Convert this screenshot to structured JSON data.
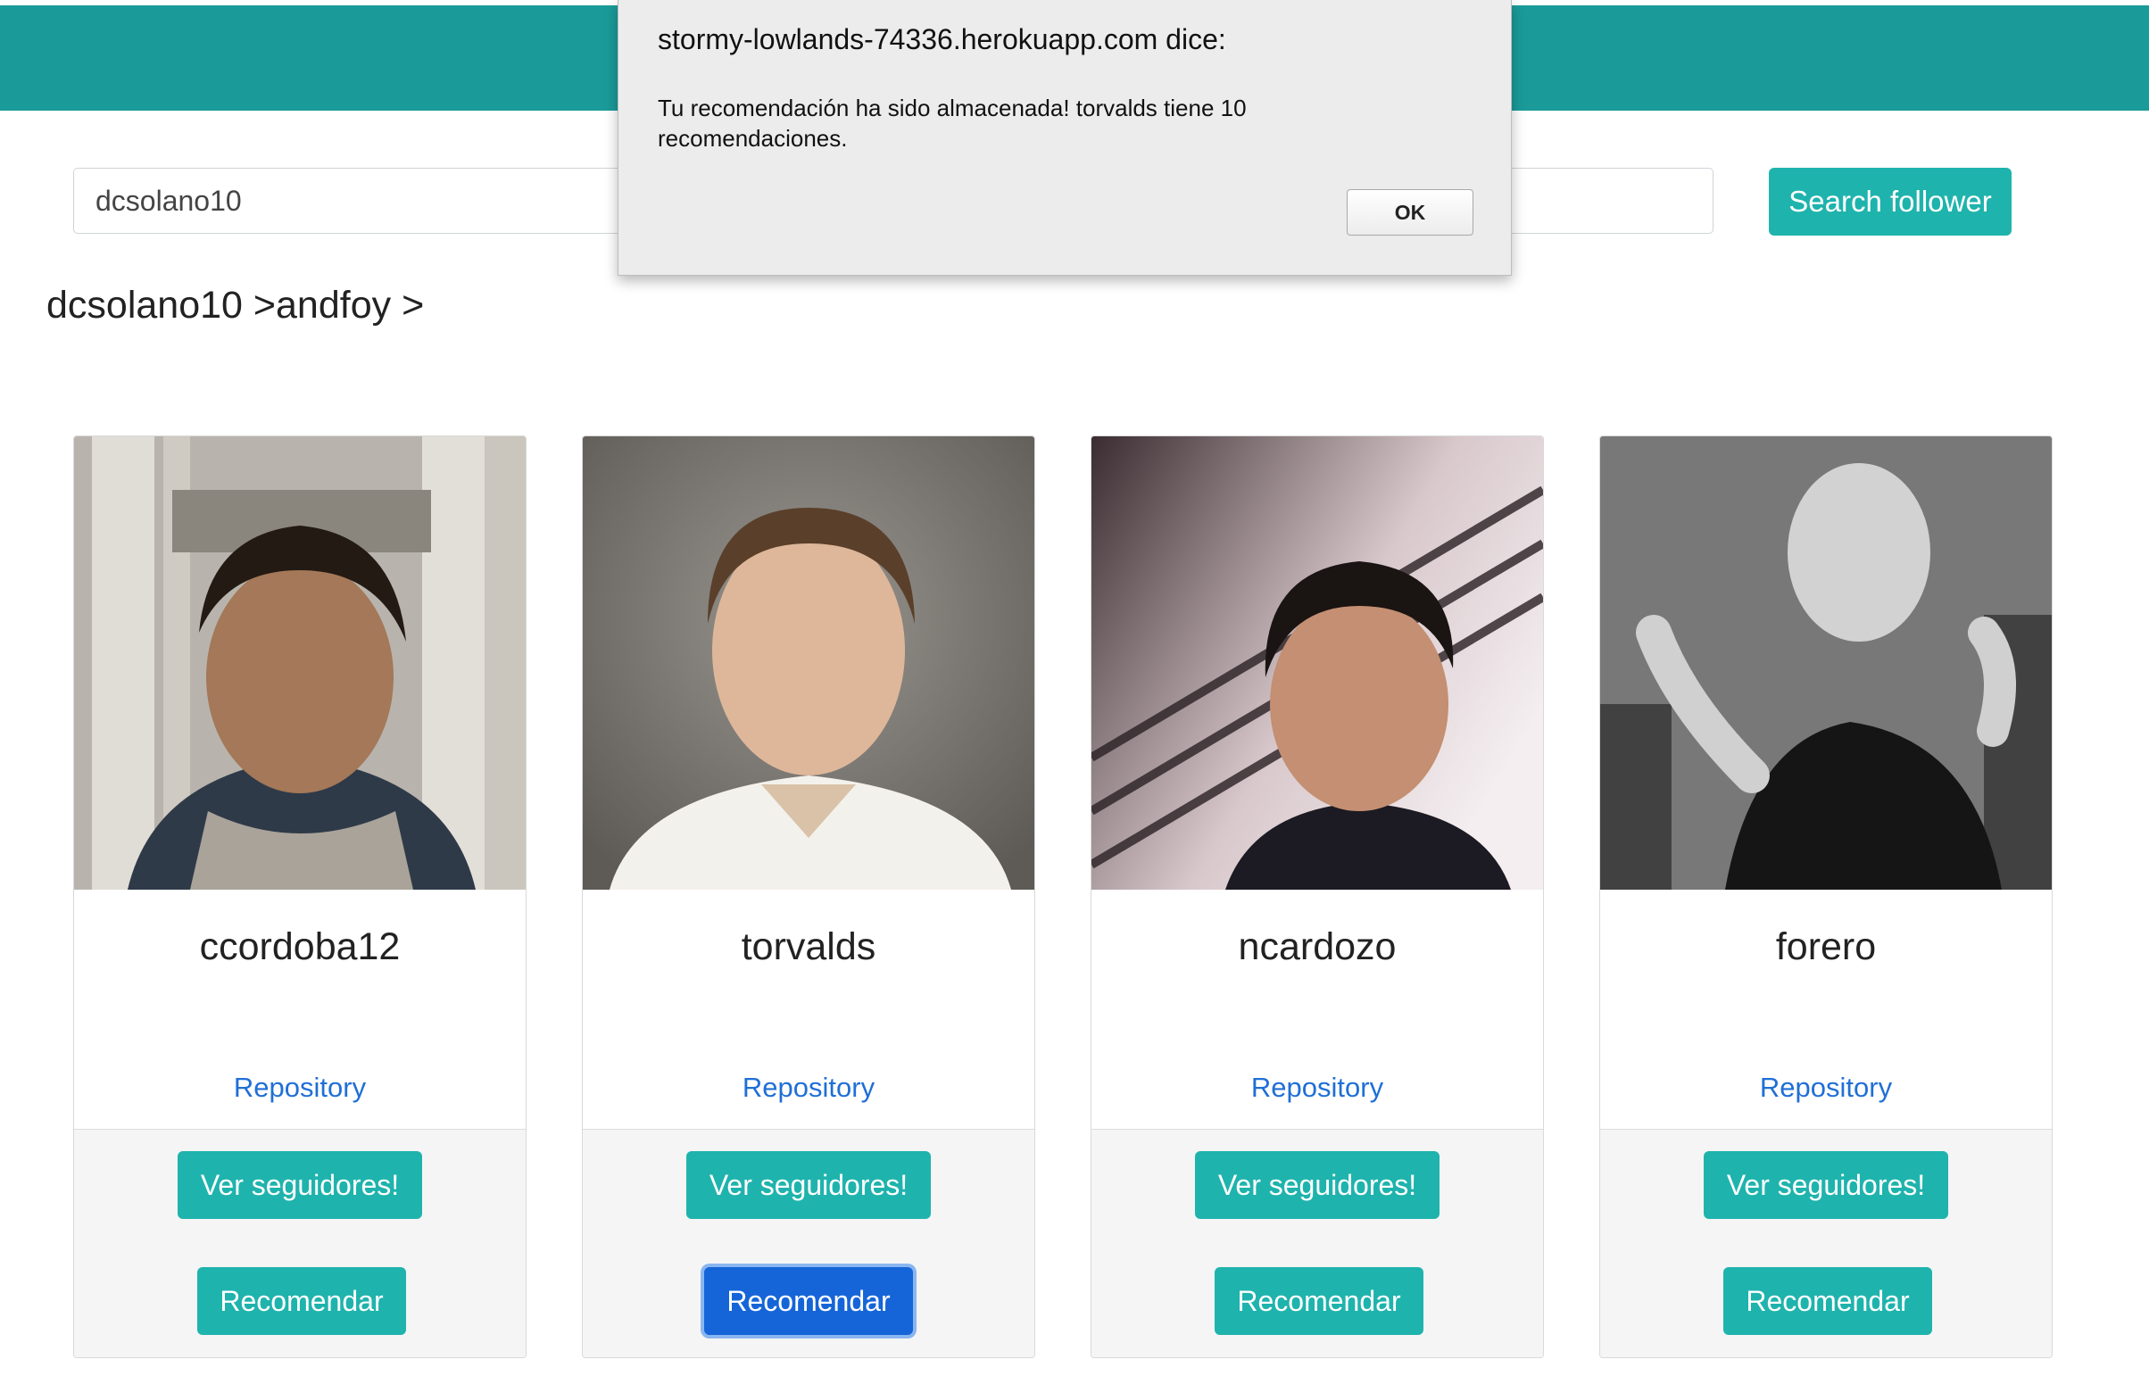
{
  "search": {
    "value": "dcsolano10",
    "button_label": "Search follower"
  },
  "breadcrumb": "dcsolano10 >andfoy >",
  "cards": [
    {
      "username": "ccordoba12",
      "link_label": "Repository",
      "view_label": "Ver seguidores!",
      "recommend_label": "Recomendar"
    },
    {
      "username": "torvalds",
      "link_label": "Repository",
      "view_label": "Ver seguidores!",
      "recommend_label": "Recomendar"
    },
    {
      "username": "ncardozo",
      "link_label": "Repository",
      "view_label": "Ver seguidores!",
      "recommend_label": "Recomendar"
    },
    {
      "username": "forero",
      "link_label": "Repository",
      "view_label": "Ver seguidores!",
      "recommend_label": "Recomendar"
    }
  ],
  "dialog": {
    "title": "stormy-lowlands-74336.herokuapp.com dice:",
    "message": "Tu recomendación ha sido almacenada! torvalds tiene 10 recomendaciones.",
    "ok_label": "OK"
  },
  "colors": {
    "topbar": "#1a9b99",
    "button": "#1fb3ad",
    "active_button": "#1565d8",
    "link": "#1f6fd6"
  },
  "icons": [
    "avatar-photo"
  ]
}
